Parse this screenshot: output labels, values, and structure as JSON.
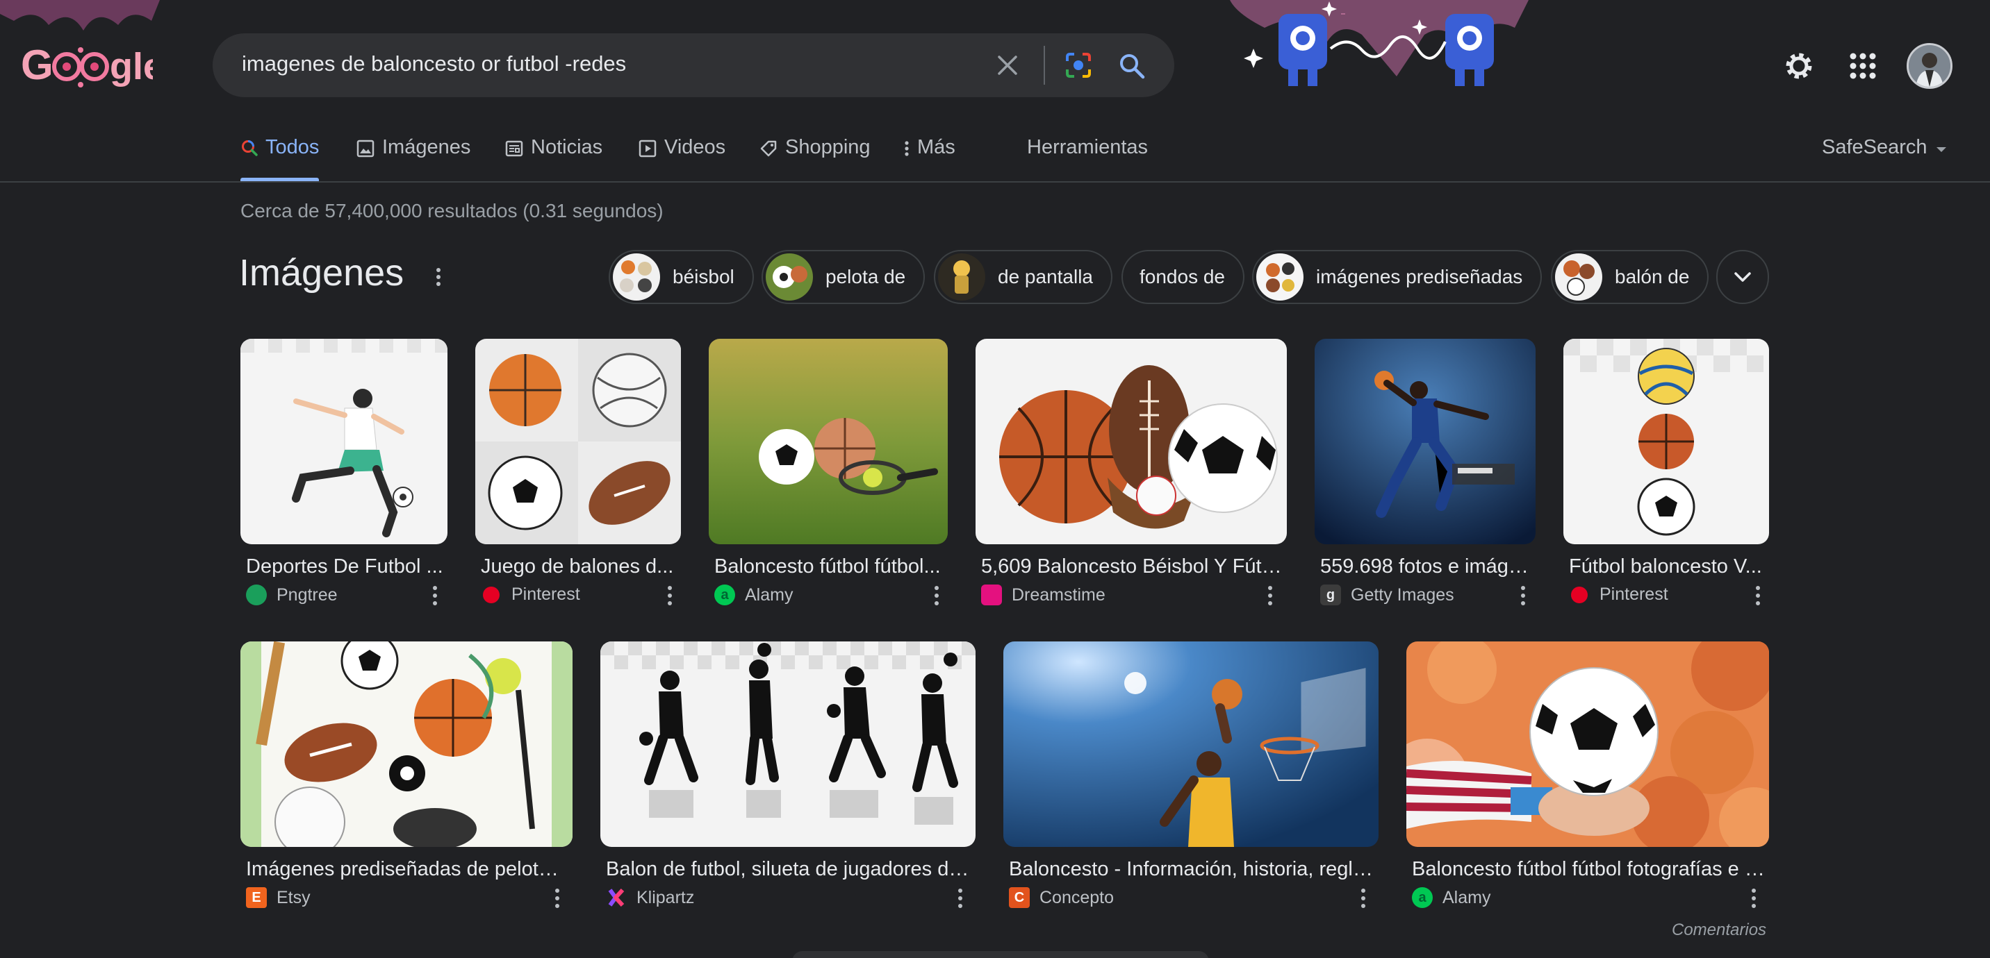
{
  "header": {
    "logo_label": "Google",
    "search": {
      "value": "imagenes de baloncesto or futbol -redes"
    }
  },
  "tabs": [
    {
      "label": "Todos",
      "active": true,
      "icon": "search-icon"
    },
    {
      "label": "Imágenes",
      "icon": "image-icon"
    },
    {
      "label": "Noticias",
      "icon": "news-icon"
    },
    {
      "label": "Videos",
      "icon": "play-icon"
    },
    {
      "label": "Shopping",
      "icon": "tag-icon"
    },
    {
      "label": "Más",
      "icon": "more-vert-icon"
    },
    {
      "label": "Herramientas"
    }
  ],
  "safesearch_label": "SafeSearch",
  "result_stats": "Cerca de 57,400,000 resultados (0.31 segundos)",
  "images_section": {
    "title": "Imágenes",
    "chips": [
      {
        "label": "béisbol"
      },
      {
        "label": "pelota de"
      },
      {
        "label": "de pantalla"
      },
      {
        "label": "fondos de"
      },
      {
        "label": "imágenes prediseñadas"
      },
      {
        "label": "balón de"
      }
    ],
    "row1": [
      {
        "title": "Deportes De Futbol ...",
        "source": "Pngtree",
        "favicon_color": "#1a9f5b",
        "favicon_glyph": ""
      },
      {
        "title": "Juego de balones d...",
        "source": "Pinterest",
        "favicon_color": "#e60023",
        "favicon_glyph": ""
      },
      {
        "title": "Baloncesto fútbol fútbol...",
        "source": "Alamy",
        "favicon_color": "#00c853",
        "favicon_glyph": "a"
      },
      {
        "title": "5,609 Baloncesto Béisbol Y Fútb...",
        "source": "Dreamstime",
        "favicon_color": "#e4117f",
        "favicon_glyph": ""
      },
      {
        "title": "559.698 fotos e imáge...",
        "source": "Getty Images",
        "favicon_color": "#3c3c3c",
        "favicon_glyph": "g"
      },
      {
        "title": "Fútbol baloncesto V...",
        "source": "Pinterest",
        "favicon_color": "#e60023",
        "favicon_glyph": ""
      }
    ],
    "row2": [
      {
        "title": "Imágenes prediseñadas de pelota ...",
        "source": "Etsy",
        "favicon_color": "#f1641e",
        "favicon_glyph": "E"
      },
      {
        "title": "Balon de futbol, silueta de jugadores de ...",
        "source": "Klipartz",
        "favicon_color": "#ff3d77",
        "favicon_glyph": "K"
      },
      {
        "title": "Baloncesto - Información, historia, regla...",
        "source": "Concepto",
        "favicon_color": "#e2531d",
        "favicon_glyph": "C"
      },
      {
        "title": "Baloncesto fútbol fútbol fotografías e i...",
        "source": "Alamy",
        "favicon_color": "#00c853",
        "favicon_glyph": "a"
      }
    ],
    "feedback_label": "Comentarios"
  }
}
